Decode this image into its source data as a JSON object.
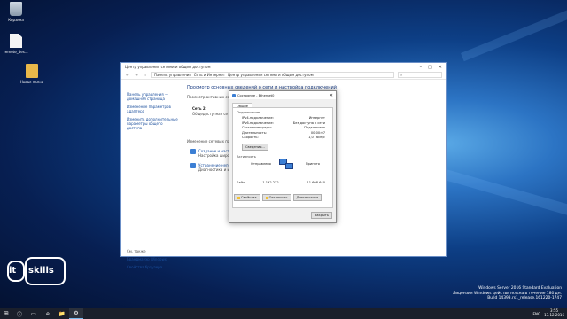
{
  "desktop": {
    "icons": [
      {
        "name": "recycle-bin",
        "label": "Корзина"
      },
      {
        "name": "file",
        "label": "remote_des..."
      },
      {
        "name": "folder",
        "label": "Новая папка"
      }
    ]
  },
  "control_panel": {
    "title": "Центр управления сетями и общим доступом",
    "window_buttons": {
      "minimize": "–",
      "maximize": "□",
      "close": "✕"
    },
    "address": {
      "back": "←",
      "forward": "→",
      "up": "↑",
      "crumbs": [
        "Панель управления",
        "Сеть и Интернет",
        "Центр управления сетями и общим доступом"
      ],
      "search_icon": "⌕"
    },
    "sidebar": {
      "items": [
        "Панель управления — домашняя страница",
        "Изменение параметров адаптера",
        "Изменить дополнительные параметры общего доступа"
      ],
      "see_also_label": "См. также",
      "see_also": [
        "Брандмауэр Windows",
        "Свойства браузера"
      ]
    },
    "main": {
      "heading": "Просмотр основных сведений о сети и настройка подключений",
      "active_networks_label": "Просмотр активных сетей",
      "network_name": "Сеть 2",
      "network_category": "Общедоступная сеть",
      "change_label": "Изменение сетевых парамет",
      "tasks": [
        {
          "title": "Создание и настр",
          "desc": "Настройка широ маршрутизатора"
        },
        {
          "title": "Устранение непо",
          "desc": "Диагностика и исп неполадок."
        }
      ]
    }
  },
  "status_dialog": {
    "title": "Состояние - Ethernet0",
    "tab": "Общие",
    "connection_label": "Подключение",
    "rows": [
      {
        "label": "IPv4-подключение:",
        "value": "Интернет"
      },
      {
        "label": "IPv6-подключение:",
        "value": "Без доступа к сети"
      },
      {
        "label": "Состояние среды:",
        "value": "Подключено"
      },
      {
        "label": "Длительность:",
        "value": "00:00:07"
      },
      {
        "label": "Скорость:",
        "value": "1,0 Гбит/с"
      }
    ],
    "details_button": "Сведения...",
    "activity_label": "Активность",
    "sent_label": "Отправлено",
    "received_label": "Принято",
    "bytes_label": "Байт:",
    "bytes_sent": "1 192 232",
    "bytes_received": "11 608 640",
    "properties_button": "Свойства",
    "disable_button": "Отключить",
    "diagnose_button": "Диагностика",
    "close_button": "Закрыть",
    "close_icon": "✕"
  },
  "logo": {
    "part1": "it",
    "part2": "skills"
  },
  "watermark": {
    "line1": "Windows Server 2016 Standard Evaluation",
    "line2": "Лицензия Windows действительна в течение 180 дн.",
    "line3": "Build 14393.rs1_release.161220-1747"
  },
  "taskbar": {
    "start_icon": "⊞",
    "icons": [
      "ⓘ",
      "▭",
      "e",
      "📁",
      "⚙"
    ],
    "tray": {
      "lang": "ENG",
      "time": "3:55",
      "date": "17.12.2016"
    }
  },
  "colors": {
    "accent": "#0d3f86",
    "link": "#1a4e9c",
    "taskbar": "#1a1f2b"
  }
}
